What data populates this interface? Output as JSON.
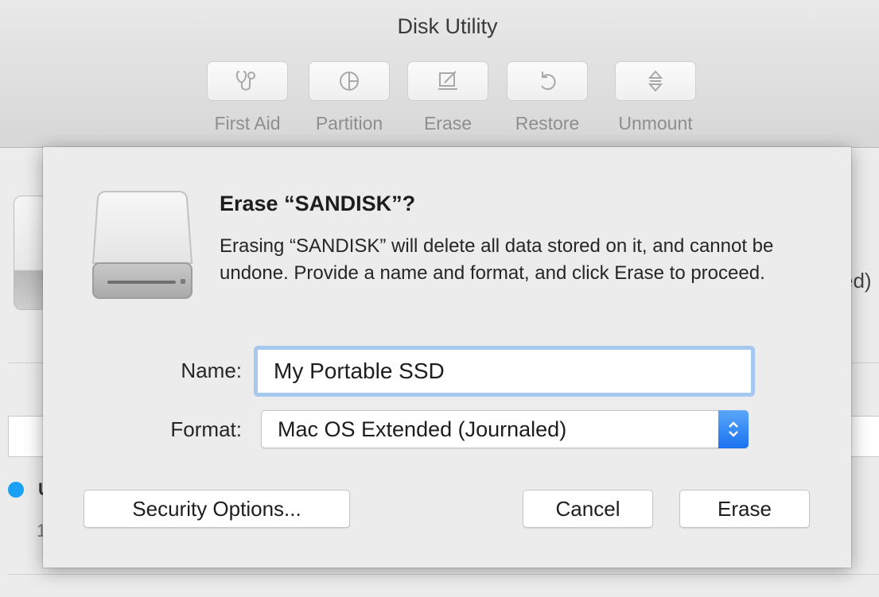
{
  "window": {
    "title": "Disk Utility"
  },
  "toolbar": {
    "items": [
      {
        "label": "First Aid",
        "icon": "stethoscope-icon"
      },
      {
        "label": "Partition",
        "icon": "pie-chart-icon"
      },
      {
        "label": "Erase",
        "icon": "eraser-icon"
      },
      {
        "label": "Restore",
        "icon": "restore-icon"
      },
      {
        "label": "Unmount",
        "icon": "unmount-icon"
      }
    ]
  },
  "background": {
    "partial_text": "ed)",
    "partial_char_1": "U",
    "partial_char_2": "1"
  },
  "dialog": {
    "icon": "external-drive-icon",
    "title": "Erase “SANDISK”?",
    "message": "Erasing “SANDISK” will delete all data stored on it, and cannot be undone. Provide a name and format, and click Erase to proceed.",
    "name_label": "Name:",
    "name_value": "My Portable SSD",
    "format_label": "Format:",
    "format_value": "Mac OS Extended (Journaled)",
    "security_options_label": "Security Options...",
    "cancel_label": "Cancel",
    "erase_label": "Erase"
  },
  "colors": {
    "accent": "#1a72ef",
    "focus_ring": "#a6c8ef",
    "status_dot": "#1aa0f5"
  }
}
